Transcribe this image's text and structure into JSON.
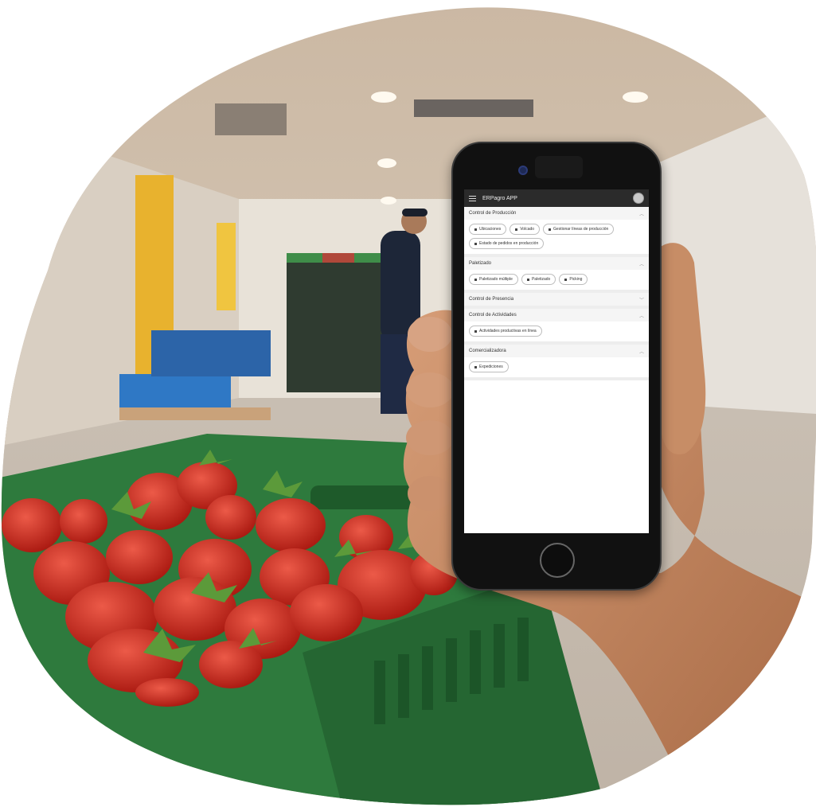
{
  "app": {
    "title": "ERPagro APP"
  },
  "sections": [
    {
      "title": "Control de Producción",
      "expanded": true,
      "chips": [
        "Ubicaciones",
        "Volcado",
        "Gestionar líneas de producción",
        "Estado de pedidos en producción"
      ]
    },
    {
      "title": "Paletizado",
      "expanded": true,
      "chips": [
        "Paletizado múltiple",
        "Paletizado",
        "Picking"
      ]
    },
    {
      "title": "Control de Presencia",
      "expanded": false,
      "chips": []
    },
    {
      "title": "Control de Actividades",
      "expanded": true,
      "chips": [
        "Actividades productivas en línea"
      ]
    },
    {
      "title": "Comercializadora",
      "expanded": true,
      "chips": [
        "Expediciones"
      ]
    }
  ],
  "colors": {
    "crate_green": "#2f7a3e",
    "strawberry_red": "#c8231c",
    "appbar": "#2b2b2b"
  }
}
